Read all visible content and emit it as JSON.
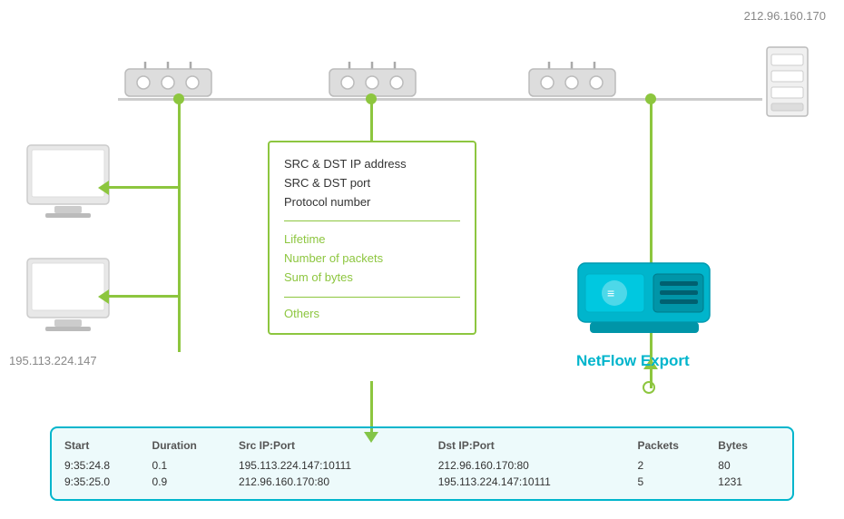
{
  "ip_top_right": "212.96.160.170",
  "ip_bottom_left": "195.113.224.147",
  "info_box": {
    "line1": "SRC & DST IP address",
    "line2": "SRC & DST port",
    "line3": "Protocol number",
    "sub_line1": "Lifetime",
    "sub_line2": "Number of packets",
    "sub_line3": "Sum of bytes",
    "others": "Others"
  },
  "netflow_label": "NetFlow Export",
  "table": {
    "headers": [
      "Start",
      "Duration",
      "Src IP:Port",
      "Dst IP:Port",
      "Packets",
      "Bytes"
    ],
    "rows": [
      [
        "9:35:24.8",
        "0.1",
        "195.113.224.147:10111",
        "212.96.160.170:80",
        "2",
        "80"
      ],
      [
        "9:35:25.0",
        "0.9",
        "212.96.160.170:80",
        "195.113.224.147:10111",
        "5",
        "1231"
      ]
    ]
  }
}
